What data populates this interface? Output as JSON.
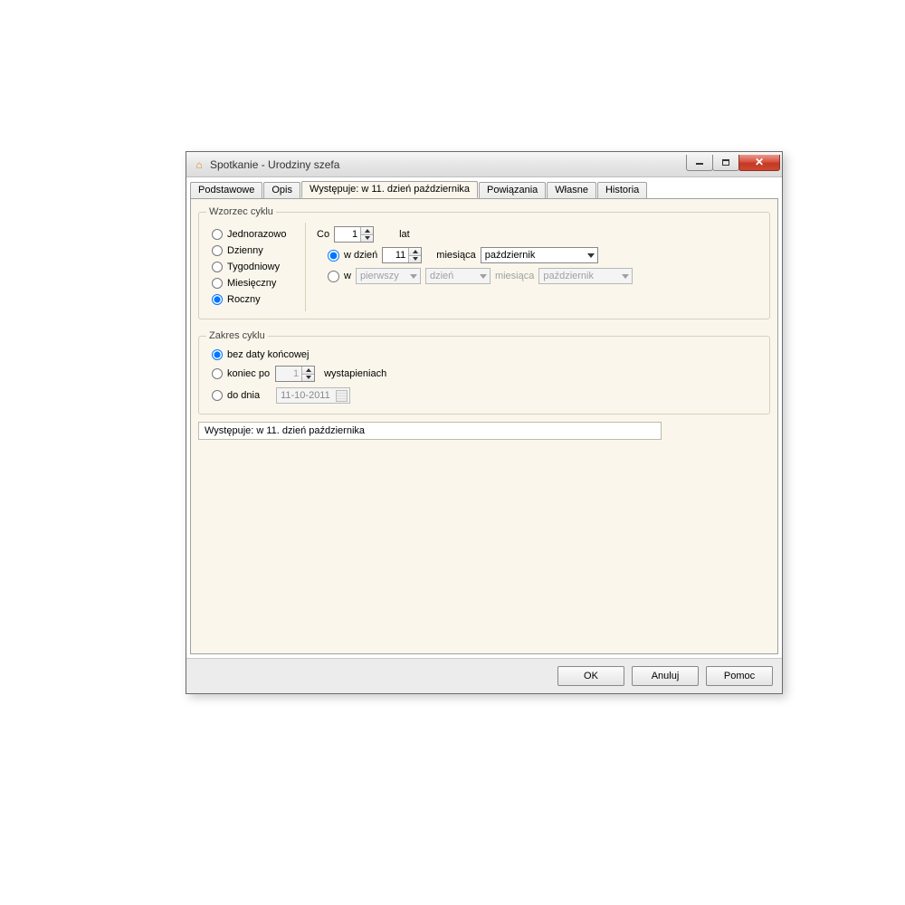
{
  "window": {
    "title": "Spotkanie - Urodziny szefa"
  },
  "tabs": {
    "t0": "Podstawowe",
    "t1": "Opis",
    "t2": "Występuje: w 11. dzień października",
    "t3": "Powiązania",
    "t4": "Własne",
    "t5": "Historia"
  },
  "pattern": {
    "legend": "Wzorzec cyklu",
    "freq": {
      "once": "Jednorazowo",
      "daily": "Dzienny",
      "weekly": "Tygodniowy",
      "monthly": "Miesięczny",
      "yearly": "Roczny"
    },
    "every_label": "Co",
    "every_value": "1",
    "years_label": "lat",
    "onday_label": "w dzień",
    "onday_value": "11",
    "ofmonth_label": "miesiąca",
    "month_value": "październik",
    "on_label": "w",
    "ordinal_value": "pierwszy",
    "dayname_value": "dzień",
    "ofmonth2_label": "miesiąca",
    "month2_value": "październik"
  },
  "range": {
    "legend": "Zakres cyklu",
    "noend": "bez daty końcowej",
    "endafter": "koniec po",
    "endafter_value": "1",
    "occurrences_label": "wystapieniach",
    "endby": "do dnia",
    "endby_value": "11-10-2011"
  },
  "summary": "Występuje: w 11. dzień października",
  "buttons": {
    "ok": "OK",
    "cancel": "Anuluj",
    "help": "Pomoc"
  }
}
